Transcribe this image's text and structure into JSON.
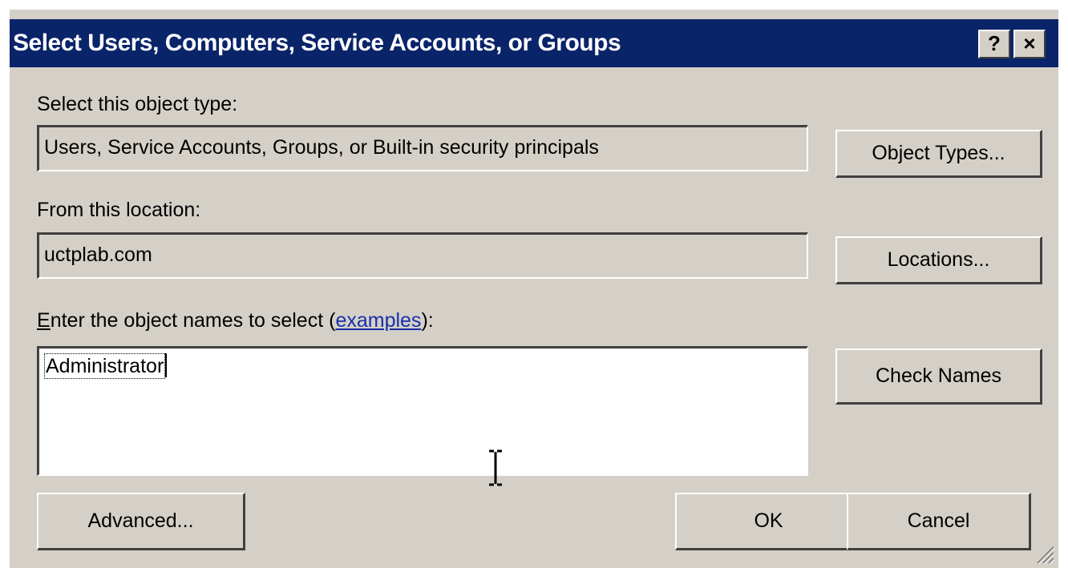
{
  "dialog": {
    "title": "Select Users, Computers, Service Accounts, or Groups",
    "help_label": "?",
    "close_label": "×"
  },
  "object_type": {
    "label": "Select this object type:",
    "value": "Users, Service Accounts, Groups, or Built-in security principals",
    "button_label": "Object Types..."
  },
  "location": {
    "label": "From this location:",
    "value": "uctplab.com",
    "button_label": "Locations..."
  },
  "names": {
    "label_accel": "E",
    "label_rest": "nter the object names to select (",
    "link_text": "examples",
    "label_end": "):",
    "value": "Administrator",
    "button_label": "Check Names"
  },
  "footer": {
    "advanced_label": "Advanced...",
    "ok_label": "OK",
    "cancel_label": "Cancel"
  },
  "colors": {
    "titlebar": "#0a246a",
    "face": "#d4d0c8",
    "link": "#1a2ea8"
  }
}
